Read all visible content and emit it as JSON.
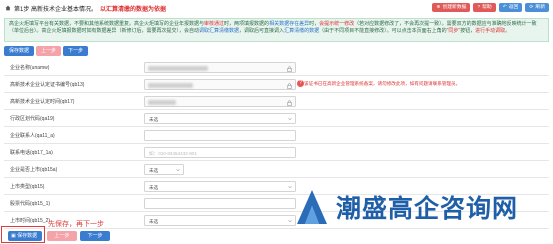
{
  "header": {
    "step_title": "第1步  高新技术企业基本情况。",
    "step_hint": "以汇算清缴的数据为依据"
  },
  "top_buttons": [
    {
      "label": "创建新数据",
      "color": "#e05a5a"
    },
    {
      "label": "帮助",
      "color": "#e05a5a"
    },
    {
      "label": "返回",
      "color": "#4a8fd8"
    },
    {
      "label": "刷新",
      "color": "#4a8fd8"
    }
  ],
  "notice": {
    "part1": "高企火炬填写平台",
    "part2": "有关数据，不要和其他系统数据重复。高企火炬填写的企业年报数据与",
    "red1": "审核通过",
    "part3": "时，两项填报数据的",
    "blue1": "相关数据存在差异",
    "part4": "时，",
    "red2": "会提示统一修改",
    "part5": "（若对应数据修改了，不会再次提一致）。需要双方的数据应与准确地反映统计一致（单位后台）。高企火炬填报数据时",
    "part6": "如有数据差异（新修订后，需要再次提交），会自动",
    "blue2": "调取汇算清缴数据",
    "part7": "，调取后可直接调入",
    "blue3": "汇算清缴的数据",
    "part8": "（由于不同项目不能直接修改）。可以点击本页面右上角的",
    "red3": "\"同步\"",
    "part9": "按钮，",
    "red4": "进行手动调取",
    "part10": "。"
  },
  "pager": {
    "save": "保存数据",
    "prev": "上一步",
    "next": "下一步"
  },
  "form": {
    "rows": [
      {
        "label": "企业名称(unamw)",
        "type": "locked"
      },
      {
        "label": "高新技术企业认定证书编号(qb13)",
        "type": "locked",
        "note": "该证书已在高新企业管理系统备案，请勿修改此项，如有问题请联系管理员。"
      },
      {
        "label": "高新技术企业认定时间(qb17)",
        "type": "locked"
      },
      {
        "label": "行政区划代码(qa19)",
        "type": "select",
        "value": "未选"
      },
      {
        "label": "企业联系人(qa11_a)",
        "type": "input",
        "value": ""
      },
      {
        "label": "联系电话(qb17_1a)",
        "type": "input",
        "value": "如：010-83454432-801"
      },
      {
        "label": "企业是否上市(qb15a)",
        "type": "select_small",
        "value": "未选"
      },
      {
        "label": "上市类型(qb15)",
        "type": "select",
        "value": "未选"
      },
      {
        "label": "股票代码(qb15_1)",
        "type": "input",
        "value": ""
      },
      {
        "label": "上市时间(qb15_2)",
        "type": "select",
        "value": "未选"
      }
    ]
  },
  "bottom": {
    "save": "保存数据",
    "prev": "上一步",
    "next": "下一步",
    "annotation": "先保存，再下一步"
  },
  "watermark": {
    "text": "潮盛高企咨询网"
  },
  "colors": {
    "blue": "#3a7dd0",
    "pink": "#f4a3a8",
    "red": "#e03b3b",
    "notice_bg": "#e8f4ee"
  }
}
